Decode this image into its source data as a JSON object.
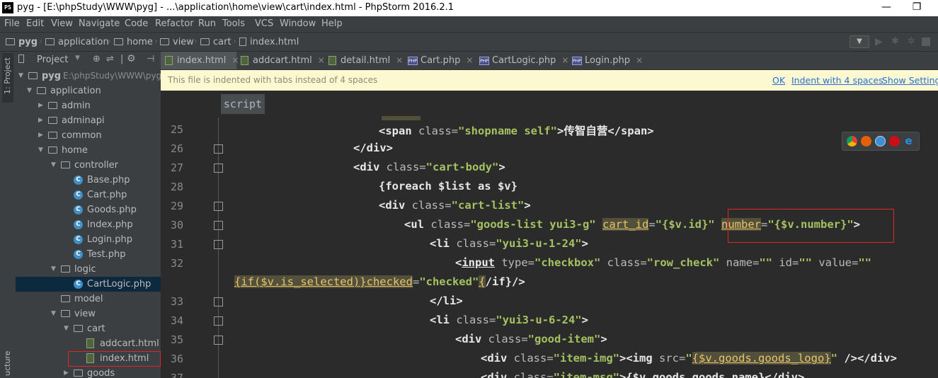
{
  "window": {
    "app_icon": "PS",
    "title": "pyg - [E:\\phpStudy\\WWW\\pyg] - ...\\application\\home\\view\\cart\\index.html - PhpStorm 2016.2.1",
    "minimize": "—",
    "restore": "❐"
  },
  "menu": [
    "File",
    "Edit",
    "View",
    "Navigate",
    "Code",
    "Refactor",
    "Run",
    "Tools",
    "VCS",
    "Window",
    "Help"
  ],
  "breadcrumb": [
    "pyg",
    "application",
    "home",
    "view",
    "cart",
    "index.html"
  ],
  "toolbar_icons": [
    "run-config-dropdown",
    "run-icon",
    "debug-icon",
    "coverage-icon",
    "stop-icon",
    "search-icon"
  ],
  "left_strip": {
    "project_label": "1: Project",
    "structure_label": "ucture"
  },
  "project_panel": {
    "title": "Project",
    "header_icons": [
      "collapse-icon",
      "scroll-icon",
      "settings-icon",
      "hide-icon"
    ],
    "tree": [
      {
        "label": "pyg",
        "suffix": "E:\\phpStudy\\WWW\\pyg",
        "type": "folder",
        "level": 0,
        "arrow": "down",
        "bold": true
      },
      {
        "label": "application",
        "type": "folder",
        "level": 1,
        "arrow": "down"
      },
      {
        "label": "admin",
        "type": "folder",
        "level": 2,
        "arrow": "right"
      },
      {
        "label": "adminapi",
        "type": "folder",
        "level": 2,
        "arrow": "right"
      },
      {
        "label": "common",
        "type": "folder",
        "level": 2,
        "arrow": "right"
      },
      {
        "label": "home",
        "type": "folder",
        "level": 2,
        "arrow": "down"
      },
      {
        "label": "controller",
        "type": "folder",
        "level": 3,
        "arrow": "down"
      },
      {
        "label": "Base.php",
        "type": "class",
        "level": 4
      },
      {
        "label": "Cart.php",
        "type": "class",
        "level": 4
      },
      {
        "label": "Goods.php",
        "type": "class",
        "level": 4
      },
      {
        "label": "Index.php",
        "type": "class",
        "level": 4
      },
      {
        "label": "Login.php",
        "type": "class",
        "level": 4
      },
      {
        "label": "Test.php",
        "type": "class",
        "level": 4
      },
      {
        "label": "logic",
        "type": "folder",
        "level": 3,
        "arrow": "down"
      },
      {
        "label": "CartLogic.php",
        "type": "class",
        "level": 4,
        "selected": true
      },
      {
        "label": "model",
        "type": "folder",
        "level": 3,
        "arrow": "none"
      },
      {
        "label": "view",
        "type": "folder",
        "level": 3,
        "arrow": "down"
      },
      {
        "label": "cart",
        "type": "folder",
        "level": 4,
        "arrow": "down"
      },
      {
        "label": "addcart.html",
        "type": "html",
        "level": 5
      },
      {
        "label": "index.html",
        "type": "html",
        "level": 5,
        "highlighted": true
      },
      {
        "label": "goods",
        "type": "folder",
        "level": 4,
        "arrow": "right"
      }
    ]
  },
  "tabs": [
    {
      "label": "index.html",
      "type": "html",
      "active": true
    },
    {
      "label": "addcart.html",
      "type": "html"
    },
    {
      "label": "detail.html",
      "type": "html"
    },
    {
      "label": "Cart.php",
      "type": "php"
    },
    {
      "label": "CartLogic.php",
      "type": "php"
    },
    {
      "label": "Login.php",
      "type": "php"
    }
  ],
  "notification": {
    "message": "This file is indented with tabs instead of 4 spaces",
    "ok": "OK",
    "indent": "Indent with 4 spaces",
    "settings": "Show Settings"
  },
  "editor": {
    "crumb": "script",
    "line_numbers": [
      "25",
      "26",
      "27",
      "28",
      "29",
      "30",
      "31",
      "32",
      "33",
      "34",
      "35",
      "36",
      "37"
    ],
    "browser_icons": [
      "chrome-icon",
      "firefox-icon",
      "safari-icon",
      "opera-icon",
      "ie-icon"
    ],
    "code": {
      "l25a": "<span ",
      "l25b": "class=",
      "l25c": "\"shopname self\"",
      "l25d": ">传智自营</span>",
      "l26": "</div>",
      "l27a": "<div ",
      "l27b": "class=",
      "l27c": "\"cart-body\"",
      "l27d": ">",
      "l28": "{foreach $list as $v}",
      "l29a": "<div ",
      "l29b": "class=",
      "l29c": "\"cart-list\"",
      "l29d": ">",
      "l30a": "<ul ",
      "l30b": "class=",
      "l30c": "\"goods-list yui3-g\"",
      "l30d": " ",
      "l30e": "cart_id",
      "l30f": "=",
      "l30g": "\"{$v.id}\"",
      "l30h": " ",
      "l30i": "number",
      "l30j": "=",
      "l30k": "\"{$v.number}\"",
      "l30l": ">",
      "l31a": "<li ",
      "l31b": "class=",
      "l31c": "\"yui3-u-1-24\"",
      "l31d": ">",
      "l32a": "<",
      "l32b": "input",
      "l32c": " type=",
      "l32d": "\"checkbox\"",
      "l32e": " class=",
      "l32f": "\"row_check\"",
      "l32g": " name=",
      "l32h": "\"\"",
      "l32i": " id=",
      "l32j": "\"\"",
      "l32k": " value=",
      "l32l": "\"\"",
      "l32ma": "{if($v.is_selected)}",
      "l32mb": "checked",
      "l32mc": "=",
      "l32md": "\"checked\"",
      "l32me": "{",
      "l32mf": "/if}/>",
      "l33": "</li>",
      "l34a": "<li ",
      "l34b": "class=",
      "l34c": "\"yui3-u-6-24\"",
      "l34d": ">",
      "l35a": "<div ",
      "l35b": "class=",
      "l35c": "\"good-item\"",
      "l35d": ">",
      "l36a": "<div ",
      "l36b": "class=",
      "l36c": "\"item-img\"",
      "l36d": "><img ",
      "l36e": "src=",
      "l36f": "\"",
      "l36g": "{$v.goods.goods_logo}",
      "l36h": "\"",
      "l36i": " /></div>",
      "l37a": "<div ",
      "l37b": "class=",
      "l37c": "\"item-msg\"",
      "l37d": ">{$v.goods.goods_name}</div>"
    }
  }
}
